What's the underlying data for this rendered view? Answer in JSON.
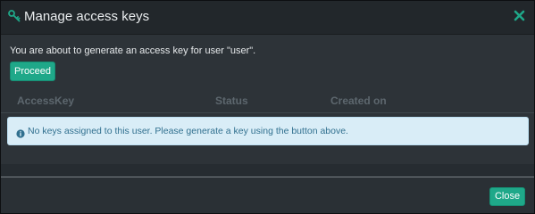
{
  "modal": {
    "title": "Manage access keys",
    "title_icon": "key-icon",
    "close_icon": "close-icon"
  },
  "body": {
    "intro_text": "You are about to generate an access key for user \"user\".",
    "proceed_label": "Proceed",
    "table": {
      "columns": [
        "AccessKey",
        "Status",
        "Created on"
      ]
    },
    "alert": {
      "icon": "info-icon",
      "text": "No keys assigned to this user. Please generate a key using the button above."
    }
  },
  "footer": {
    "close_label": "Close"
  },
  "colors": {
    "accent": "#1fa889",
    "alert_bg": "#d9edf7",
    "alert_text": "#31708f"
  }
}
